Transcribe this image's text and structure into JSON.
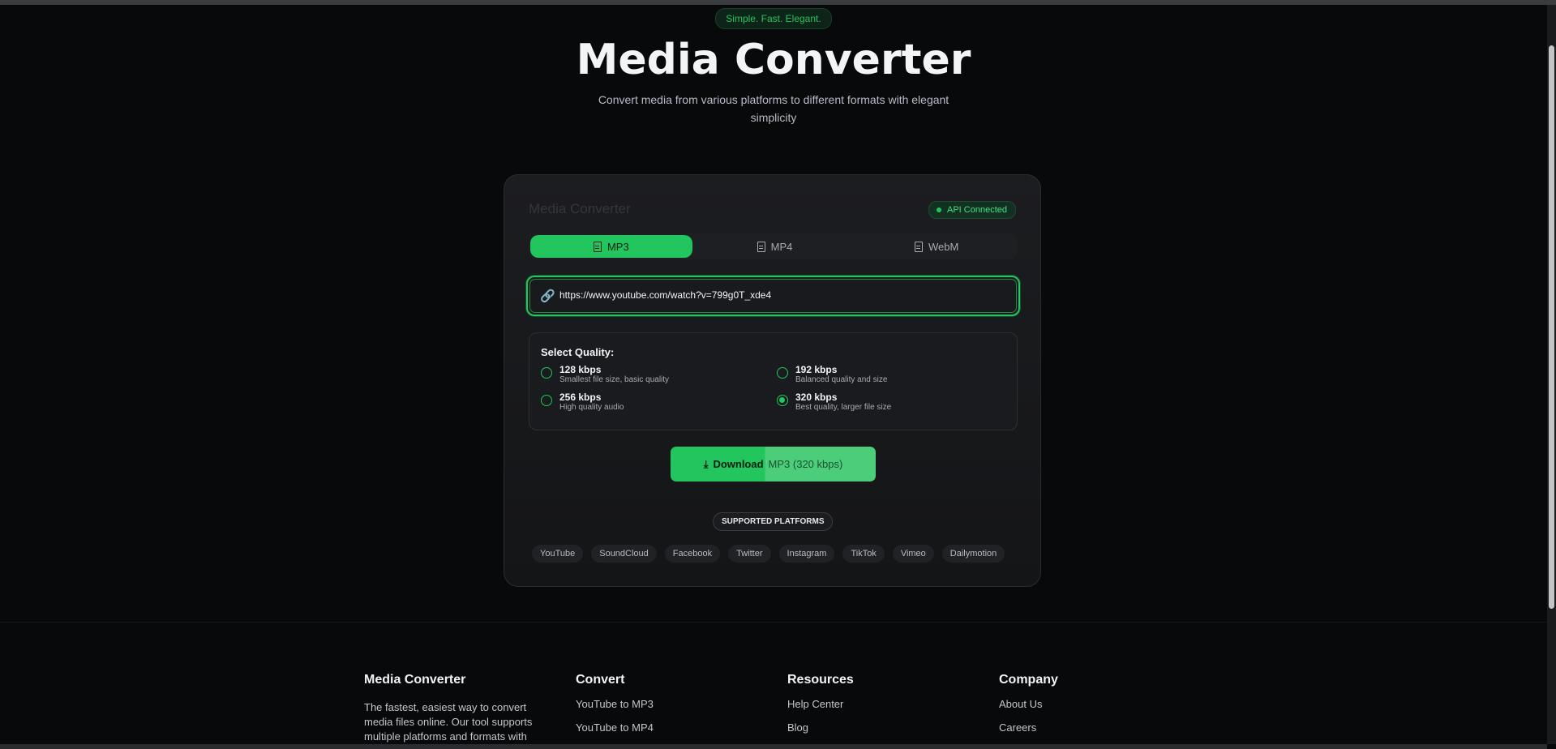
{
  "hero": {
    "tagline": "Simple. Fast. Elegant.",
    "title": "Media Converter",
    "subtitle": "Convert media from various platforms to different formats with elegant simplicity"
  },
  "card": {
    "title": "Media Converter",
    "api_status": "API Connected",
    "tabs": [
      {
        "label": "MP3",
        "icon": "file-icon",
        "active": true
      },
      {
        "label": "MP4",
        "icon": "file-icon",
        "active": false
      },
      {
        "label": "WebM",
        "icon": "file-icon",
        "active": false
      }
    ],
    "url_value": "https://www.youtube.com/watch?v=799g0T_xde4",
    "quality": {
      "label": "Select Quality:",
      "options": [
        {
          "name": "128 kbps",
          "desc": "Smallest file size, basic quality",
          "checked": false
        },
        {
          "name": "192 kbps",
          "desc": "Balanced quality and size",
          "checked": false
        },
        {
          "name": "256 kbps",
          "desc": "High quality audio",
          "checked": false
        },
        {
          "name": "320 kbps",
          "desc": "Best quality, larger file size",
          "checked": true
        }
      ]
    },
    "download": {
      "strong": "Download",
      "rest": "MP3 (320 kbps)"
    },
    "supported_label": "SUPPORTED PLATFORMS",
    "platforms": [
      "YouTube",
      "SoundCloud",
      "Facebook",
      "Twitter",
      "Instagram",
      "TikTok",
      "Vimeo",
      "Dailymotion"
    ]
  },
  "footer": {
    "about": {
      "title": "Media Converter",
      "desc": "The fastest, easiest way to convert media files online. Our tool supports multiple platforms and formats with"
    },
    "convert": {
      "title": "Convert",
      "links": [
        "YouTube to MP3",
        "YouTube to MP4"
      ]
    },
    "resources": {
      "title": "Resources",
      "links": [
        "Help Center",
        "Blog"
      ]
    },
    "company": {
      "title": "Company",
      "links": [
        "About Us",
        "Careers"
      ]
    }
  },
  "colors": {
    "accent": "#22c55e",
    "background": "#08090b",
    "card": "#1c1d20"
  }
}
